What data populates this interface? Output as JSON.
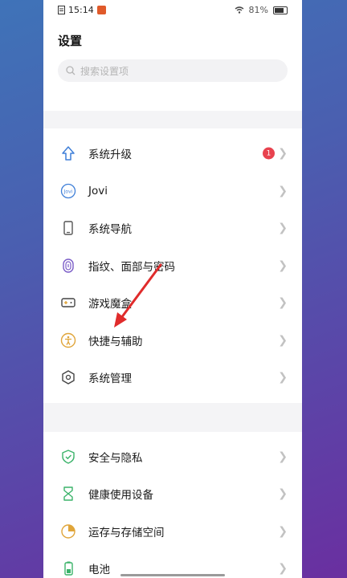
{
  "statusbar": {
    "time": "15:14",
    "battery": "81%"
  },
  "header": {
    "title": "设置",
    "search_placeholder": "搜索设置项"
  },
  "section1": [
    {
      "label": "系统升级",
      "icon": "upload-arrow-icon",
      "badge": "1"
    },
    {
      "label": "Jovi",
      "icon": "jovi-icon"
    },
    {
      "label": "系统导航",
      "icon": "phone-icon"
    },
    {
      "label": "指纹、面部与密码",
      "icon": "fingerprint-icon"
    },
    {
      "label": "游戏魔盒",
      "icon": "gamepad-icon"
    },
    {
      "label": "快捷与辅助",
      "icon": "accessibility-icon"
    },
    {
      "label": "系统管理",
      "icon": "hexagon-gear-icon"
    }
  ],
  "section2": [
    {
      "label": "安全与隐私",
      "icon": "shield-check-icon"
    },
    {
      "label": "健康使用设备",
      "icon": "hourglass-icon"
    },
    {
      "label": "运存与存储空间",
      "icon": "storage-pie-icon"
    },
    {
      "label": "电池",
      "icon": "battery-icon"
    }
  ],
  "colors": {
    "accent_blue": "#3f7fd8",
    "badge_red": "#e8424e",
    "arrow_red": "#e02b2b",
    "gold": "#e0a53a",
    "green": "#3bb36a"
  }
}
